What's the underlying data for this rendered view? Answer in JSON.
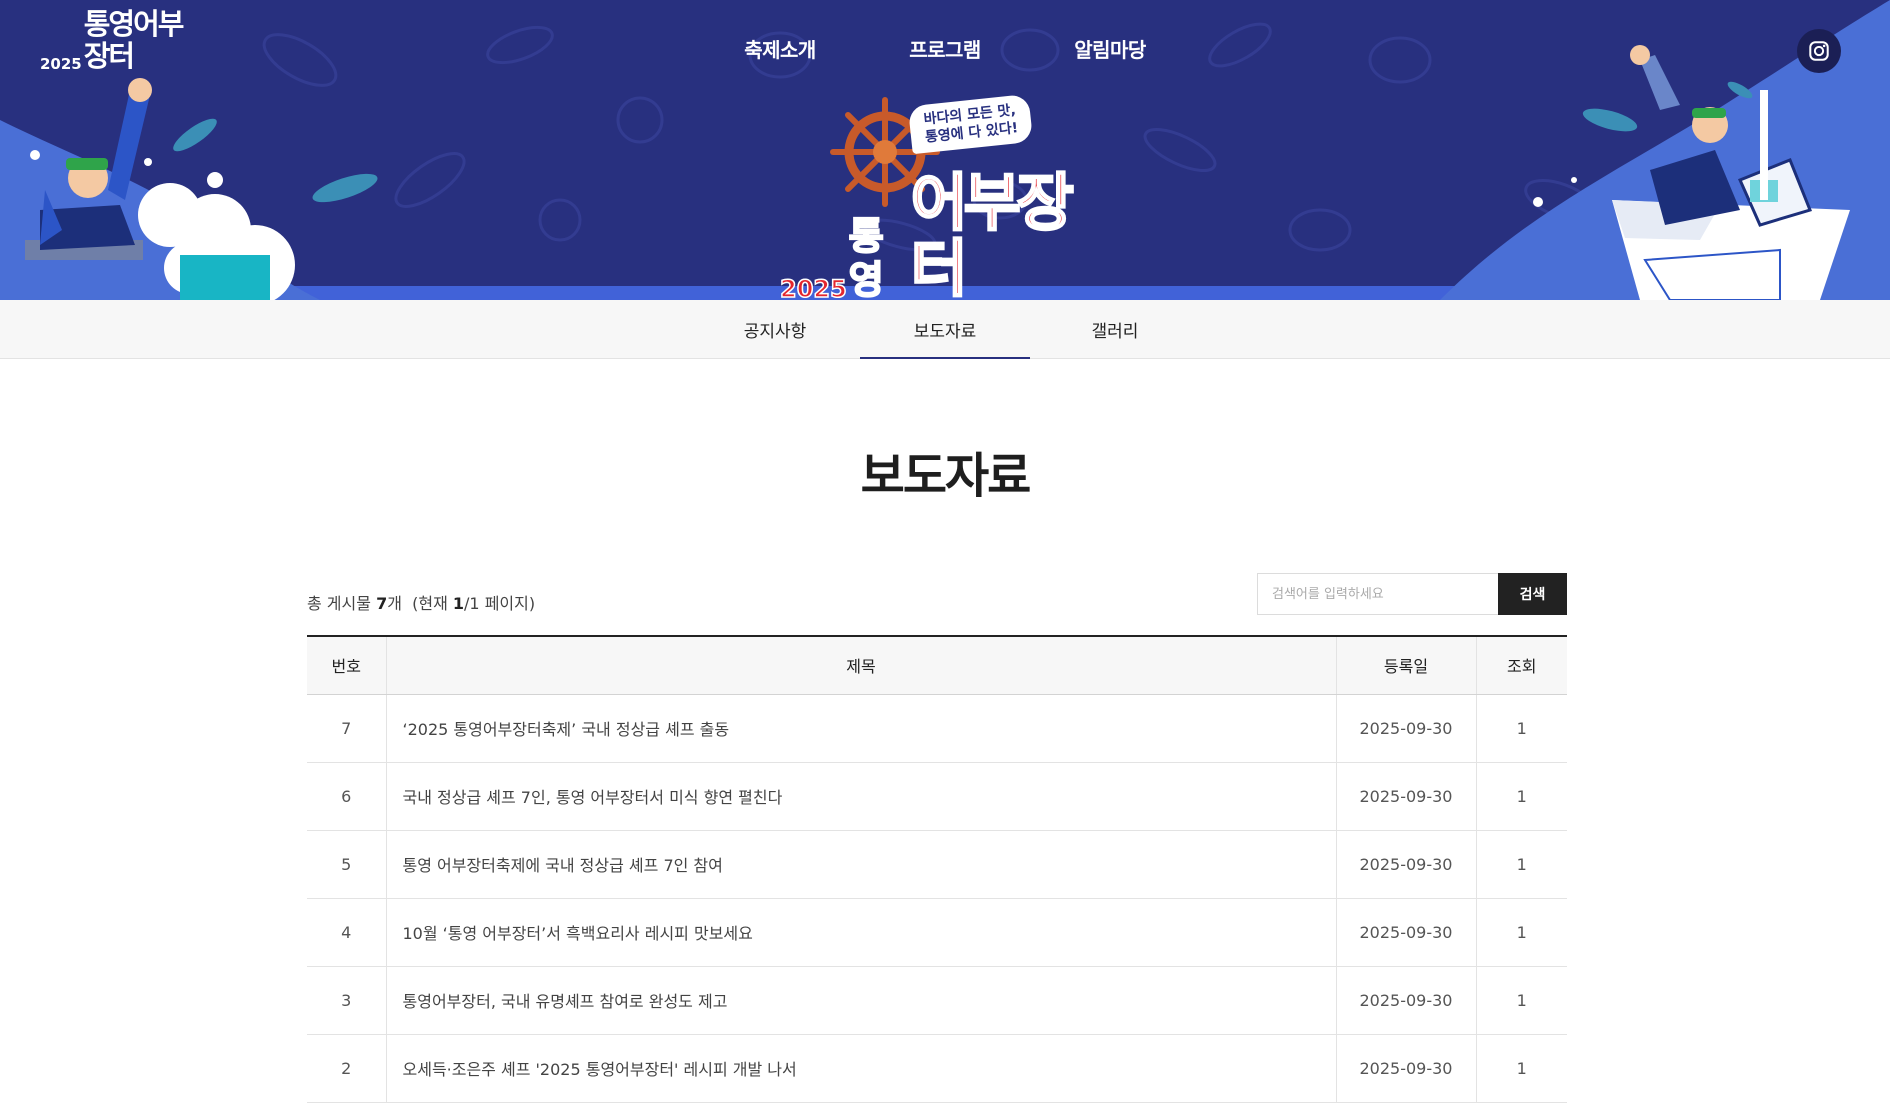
{
  "header": {
    "logo": {
      "year": "2025",
      "name": "통영어부장터"
    },
    "nav": [
      "축제소개",
      "프로그램",
      "알림마당"
    ],
    "instagram_icon": "instagram-icon",
    "badge": {
      "bubble_line1": "바다의 모든 맛,",
      "bubble_line2": "통영에 다 있다!",
      "year": "2025",
      "city": "통영",
      "name": "어부장터"
    },
    "colors": {
      "navy": "#28307f",
      "accent_red": "#e4262e",
      "sky": "#4a6fd6"
    }
  },
  "subnav": {
    "items": [
      "공지사항",
      "보도자료",
      "갤러리"
    ],
    "active": "보도자료"
  },
  "page": {
    "title": "보도자료",
    "info_prefix": "총 게시물",
    "total": "7",
    "total_suffix": "개",
    "page_prefix": "(현재",
    "current_page": "1",
    "page_sep": "/1 페이지)"
  },
  "search": {
    "placeholder": "검색어를 입력하세요",
    "button": "검색"
  },
  "table": {
    "headers": [
      "번호",
      "제목",
      "등록일",
      "조회"
    ],
    "rows": [
      {
        "no": "7",
        "title": "‘2025 통영어부장터축제’ 국내 정상급 셰프 출동",
        "date": "2025-09-30",
        "views": "1"
      },
      {
        "no": "6",
        "title": "국내 정상급 셰프 7인, 통영 어부장터서 미식 향연 펼친다",
        "date": "2025-09-30",
        "views": "1"
      },
      {
        "no": "5",
        "title": "통영 어부장터축제에 국내 정상급 셰프 7인 참여",
        "date": "2025-09-30",
        "views": "1"
      },
      {
        "no": "4",
        "title": "10월 ‘통영 어부장터’서 흑백요리사 레시피 맛보세요",
        "date": "2025-09-30",
        "views": "1"
      },
      {
        "no": "3",
        "title": "통영어부장터, 국내 유명셰프 참여로 완성도 제고",
        "date": "2025-09-30",
        "views": "1"
      },
      {
        "no": "2",
        "title": "오세득·조은주 셰프 '2025 통영어부장터' 레시피 개발 나서",
        "date": "2025-09-30",
        "views": "1"
      }
    ]
  }
}
